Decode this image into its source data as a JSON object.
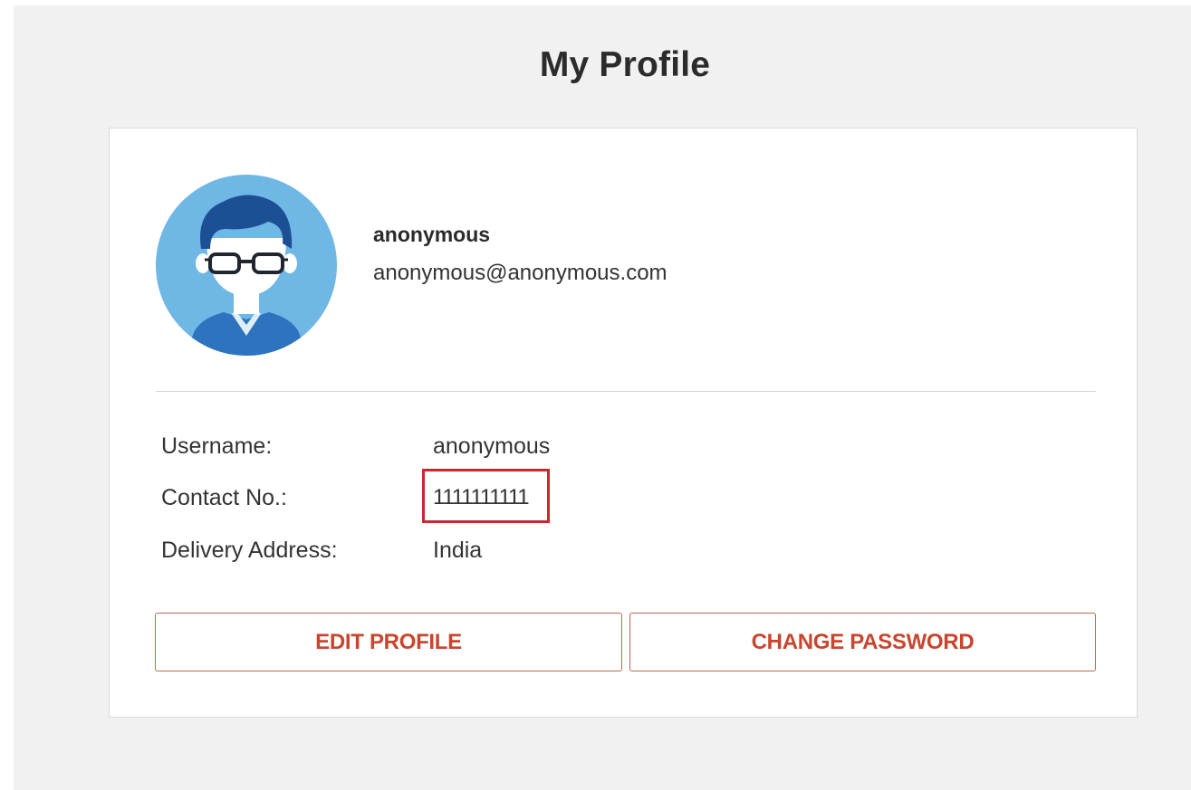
{
  "page": {
    "title": "My Profile"
  },
  "profile": {
    "display_name": "anonymous",
    "email": "anonymous@anonymous.com",
    "avatar_icon": "user-avatar-icon"
  },
  "details": {
    "username_label": "Username:",
    "username_value": "anonymous",
    "contact_label": "Contact No.:",
    "contact_value": "1111111111",
    "address_label": "Delivery Address:",
    "address_value": "India"
  },
  "actions": {
    "edit_profile_label": "EDIT PROFILE",
    "change_password_label": "CHANGE PASSWORD"
  },
  "colors": {
    "page_background": "#f1f1f1",
    "accent": "#c8452e",
    "highlight_border": "#c62a2f",
    "avatar_circle": "#6fb7e4"
  }
}
